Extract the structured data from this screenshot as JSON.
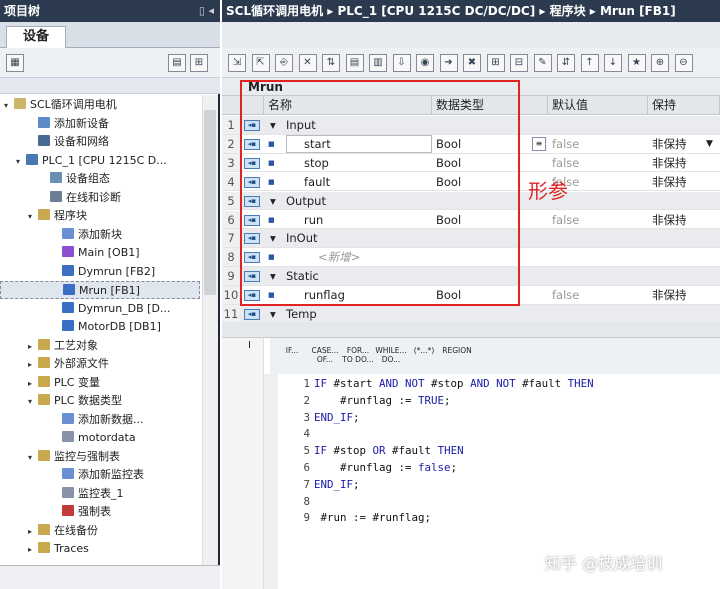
{
  "left": {
    "title": "项目树",
    "pin": "▯ ◂",
    "tab": "设备",
    "tree": [
      {
        "label": "SCL循环调用电机",
        "indent": 0,
        "tw": "▾",
        "color": "#cbb66a"
      },
      {
        "label": "添加新设备",
        "indent": 2,
        "tw": "",
        "color": "#5d8bc9"
      },
      {
        "label": "设备和网络",
        "indent": 2,
        "tw": "",
        "color": "#4a6a95"
      },
      {
        "label": "PLC_1 [CPU 1215C D...",
        "indent": 1,
        "tw": "▾",
        "color": "#4a78b3"
      },
      {
        "label": "设备组态",
        "indent": 3,
        "tw": "",
        "color": "#6a8fb5"
      },
      {
        "label": "在线和诊断",
        "indent": 3,
        "tw": "",
        "color": "#6c7f96"
      },
      {
        "label": "程序块",
        "indent": 2,
        "tw": "▾",
        "color": "#c9a94d"
      },
      {
        "label": "添加新块",
        "indent": 4,
        "tw": "",
        "color": "#6b8fd3"
      },
      {
        "label": "Main [OB1]",
        "indent": 4,
        "tw": "",
        "color": "#8a4fd3"
      },
      {
        "label": "Dymrun [FB2]",
        "indent": 4,
        "tw": "",
        "color": "#3a6fc4"
      },
      {
        "label": "Mrun [FB1]",
        "indent": 4,
        "tw": "",
        "color": "#3a6fc4",
        "sel": true
      },
      {
        "label": "Dymrun_DB [D...",
        "indent": 4,
        "tw": "",
        "color": "#3a6fc4"
      },
      {
        "label": "MotorDB [DB1]",
        "indent": 4,
        "tw": "",
        "color": "#3a6fc4"
      },
      {
        "label": "工艺对象",
        "indent": 2,
        "tw": "▸",
        "color": "#c9a94d"
      },
      {
        "label": "外部源文件",
        "indent": 2,
        "tw": "▸",
        "color": "#c9a94d"
      },
      {
        "label": "PLC 变量",
        "indent": 2,
        "tw": "▸",
        "color": "#c9a94d"
      },
      {
        "label": "PLC 数据类型",
        "indent": 2,
        "tw": "▾",
        "color": "#c9a94d"
      },
      {
        "label": "添加新数据...",
        "indent": 4,
        "tw": "",
        "color": "#6b8fd3"
      },
      {
        "label": "motordata",
        "indent": 4,
        "tw": "",
        "color": "#8893a8"
      },
      {
        "label": "监控与强制表",
        "indent": 2,
        "tw": "▾",
        "color": "#c9a94d"
      },
      {
        "label": "添加新监控表",
        "indent": 4,
        "tw": "",
        "color": "#6b8fd3"
      },
      {
        "label": "监控表_1",
        "indent": 4,
        "tw": "",
        "color": "#8893a8"
      },
      {
        "label": "强制表",
        "indent": 4,
        "tw": "",
        "color": "#c23a3a"
      },
      {
        "label": "在线备份",
        "indent": 2,
        "tw": "▸",
        "color": "#c9a94d"
      },
      {
        "label": "Traces",
        "indent": 2,
        "tw": "▸",
        "color": "#c9a94d"
      }
    ]
  },
  "breadcrumb": "SCL循环调用电机 ▸ PLC_1 [CPU 1215C DC/DC/DC] ▸ 程序块 ▸ Mrun [FB1]",
  "interface": {
    "block_name": "Mrun",
    "headers": {
      "name": "名称",
      "type": "数据类型",
      "default": "默认值",
      "retain": "保持"
    },
    "rows": [
      {
        "num": "1",
        "section": true,
        "name": "Input",
        "type": "",
        "default": "",
        "retain": ""
      },
      {
        "num": "2",
        "section": false,
        "name": "start",
        "type": "Bool",
        "default": "false",
        "retain": "非保持"
      },
      {
        "num": "3",
        "section": false,
        "name": "stop",
        "type": "Bool",
        "default": "false",
        "retain": "非保持"
      },
      {
        "num": "4",
        "section": false,
        "name": "fault",
        "type": "Bool",
        "default": "false",
        "retain": "非保持"
      },
      {
        "num": "5",
        "section": true,
        "name": "Output",
        "type": "",
        "default": "",
        "retain": ""
      },
      {
        "num": "6",
        "section": false,
        "name": "run",
        "type": "Bool",
        "default": "false",
        "retain": "非保持"
      },
      {
        "num": "7",
        "section": true,
        "name": "InOut",
        "type": "",
        "default": "",
        "retain": ""
      },
      {
        "num": "8",
        "section": false,
        "name": "<新增>",
        "type": "",
        "default": "",
        "retain": "",
        "placeholder": true
      },
      {
        "num": "9",
        "section": true,
        "name": "Static",
        "type": "",
        "default": "",
        "retain": ""
      },
      {
        "num": "10",
        "section": false,
        "name": "runflag",
        "type": "Bool",
        "default": "false",
        "retain": "非保持"
      },
      {
        "num": "11",
        "section": true,
        "name": "Temp",
        "type": "",
        "default": "",
        "retain": ""
      }
    ],
    "annotation": "形参"
  },
  "editor": {
    "marker": "I",
    "keywords": [
      "IF...",
      "CASE... OF...",
      "FOR... TO DO...",
      "WHILE... DO...",
      "(*...*)",
      "REGION"
    ],
    "lines": [
      {
        "n": "1",
        "html": "<span class='k'>IF</span> #start <span class='k'>AND NOT</span> #stop <span class='k'>AND NOT</span> #fault <span class='k'>THEN</span>"
      },
      {
        "n": "2",
        "html": "    #runflag := <span class='l'>TRUE</span>;"
      },
      {
        "n": "3",
        "html": "<span class='k'>END_IF</span>;"
      },
      {
        "n": "4",
        "html": ""
      },
      {
        "n": "5",
        "html": "<span class='k'>IF</span> #stop <span class='k'>OR</span> #fault <span class='k'>THEN</span>"
      },
      {
        "n": "6",
        "html": "    #runflag := <span class='l'>false</span>;"
      },
      {
        "n": "7",
        "html": "<span class='k'>END_IF</span>;"
      },
      {
        "n": "8",
        "html": ""
      },
      {
        "n": "9",
        "html": " #run := #runflag;"
      }
    ]
  },
  "watermark": "知乎 @技成培训",
  "colors": {
    "annotation": "#e02424",
    "titlebar": "#2b3a4e"
  }
}
